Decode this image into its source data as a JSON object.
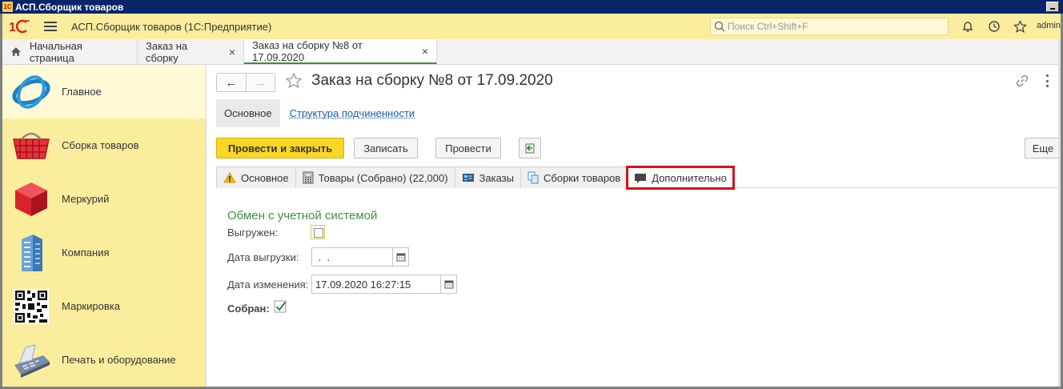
{
  "window": {
    "title": "АСП.Сборщик товаров",
    "app_title": "АСП.Сборщик товаров  (1С:Предприятие)",
    "search_placeholder": "Поиск Ctrl+Shift+F",
    "user": "admin"
  },
  "tabs": [
    {
      "label": "Начальная страница"
    },
    {
      "label": "Заказ на сборку"
    },
    {
      "label": "Заказ на сборку №8 от 17.09.2020"
    }
  ],
  "sidebar": {
    "items": [
      {
        "label": "Главное",
        "icon": "main-section-icon"
      },
      {
        "label": "Сборка товаров",
        "icon": "basket-icon"
      },
      {
        "label": "Меркурий",
        "icon": "cube-icon"
      },
      {
        "label": "Компания",
        "icon": "building-icon"
      },
      {
        "label": "Маркировка",
        "icon": "qr-code-icon"
      },
      {
        "label": "Печать и оборудование",
        "icon": "pos-terminal-icon"
      }
    ]
  },
  "document": {
    "title": "Заказ на сборку №8 от 17.09.2020",
    "section_main": "Основное",
    "section_link": "Структура подчиненности"
  },
  "toolbar": {
    "post_close": "Провести и закрыть",
    "save": "Записать",
    "post": "Провести",
    "more": "Еще"
  },
  "form_tabs": [
    {
      "label": "Основное",
      "icon": "warning-icon"
    },
    {
      "label": "Товары (Собрано) (22,000)",
      "icon": "calculator-icon"
    },
    {
      "label": "Заказы",
      "icon": "card-icon"
    },
    {
      "label": "Сборки товаров",
      "icon": "copy-icon"
    },
    {
      "label": "Дополнительно",
      "icon": "comment-icon"
    }
  ],
  "form": {
    "group_title": "Обмен с учетной системой",
    "uploaded_label": "Выгружен:",
    "uploaded_checked": false,
    "upload_date_label": "Дата выгрузки:",
    "upload_date_value": " .  .",
    "change_date_label": "Дата изменения:",
    "change_date_value": "17.09.2020 16:27:15",
    "assembled_label": "Собран:",
    "assembled_checked": true
  },
  "colors": {
    "accent_yellow": "#fbd625",
    "sidebar_bg": "#fbed9e",
    "highlight_red": "#d2121b",
    "group_green": "#3c8f45"
  }
}
